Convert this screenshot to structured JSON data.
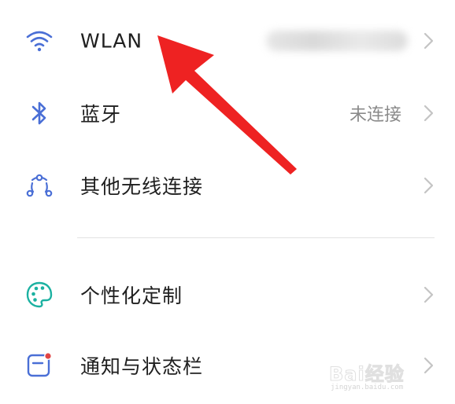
{
  "settings": {
    "items": [
      {
        "icon": "wifi-icon",
        "label": "WLAN",
        "value": "",
        "value_obscured": true
      },
      {
        "icon": "bluetooth-icon",
        "label": "蓝牙",
        "value": "未连接"
      },
      {
        "icon": "other-wireless-icon",
        "label": "其他无线连接",
        "value": ""
      },
      {
        "icon": "palette-icon",
        "label": "个性化定制",
        "value": ""
      },
      {
        "icon": "notification-statusbar-icon",
        "label": "通知与状态栏",
        "value": ""
      }
    ]
  },
  "annotation": {
    "arrow_color": "#ee2222",
    "points_to": "WLAN"
  },
  "colors": {
    "icon_blue": "#4a6fd6",
    "icon_teal": "#1bb1a1",
    "badge_red": "#e04444",
    "label_text": "#1f1f1f",
    "value_text": "#8a8a8a",
    "chevron": "#c4c4c4"
  },
  "watermark": {
    "brand": "Bai经验",
    "site": "jingyan.baidu.com"
  }
}
